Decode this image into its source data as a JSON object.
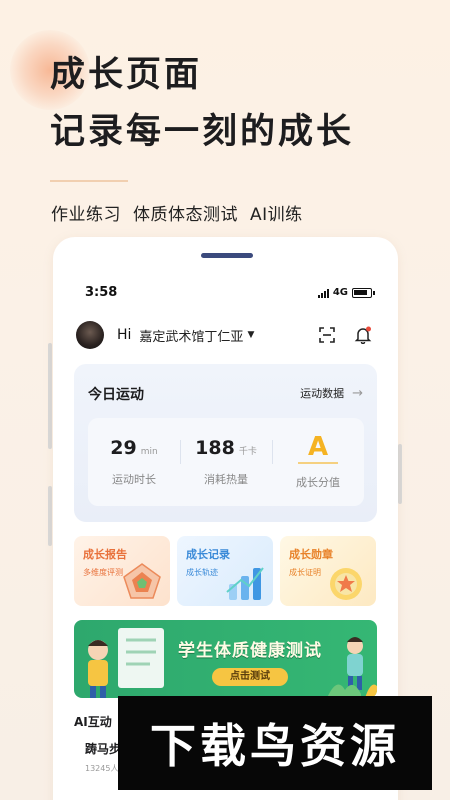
{
  "hero": {
    "line1": "成长页面",
    "line2": "记录每一刻的成长",
    "features": [
      "作业练习",
      "体质体态测试",
      "AI训练"
    ]
  },
  "phone": {
    "status": {
      "time": "3:58",
      "network": "4G"
    },
    "user": {
      "greeting": "Hi",
      "name": "嘉定武术馆丁仁亚"
    },
    "today": {
      "title": "今日运动",
      "link": "运动数据",
      "stats": [
        {
          "value": "29",
          "unit": "min",
          "label": "运动时长"
        },
        {
          "value": "188",
          "unit": "千卡",
          "label": "消耗热量"
        },
        {
          "grade": "A",
          "label": "成长分值"
        }
      ]
    },
    "cards": [
      {
        "title": "成长报告",
        "subtitle": "多维度评测"
      },
      {
        "title": "成长记录",
        "subtitle": "成长轨迹"
      },
      {
        "title": "成长勋章",
        "subtitle": "成长证明"
      }
    ],
    "banner": {
      "title": "学生体质健康测试",
      "button": "点击测试"
    },
    "ai": {
      "heading": "AI互动",
      "item_name": "踌马步",
      "item_count": "13245人"
    }
  },
  "watermark": "下载鸟资源",
  "colors": {
    "accent_green": "#2ea86d",
    "grade_gold": "#f5b323",
    "report_orange": "#e8703a",
    "record_blue": "#3a8ad8"
  }
}
